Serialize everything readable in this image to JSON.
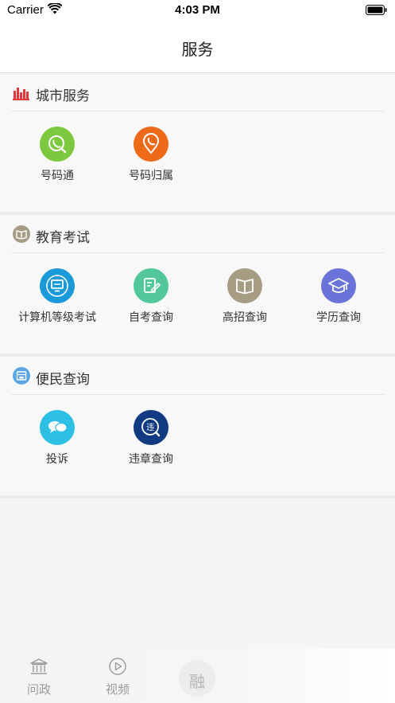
{
  "status_bar": {
    "carrier": "Carrier",
    "time": "4:03 PM"
  },
  "nav": {
    "title": "服务"
  },
  "sections": [
    {
      "title": "城市服务",
      "icon": "city-skyline-icon",
      "color": "#e4393c",
      "items": [
        {
          "label": "号码通",
          "icon": "phone-search-icon",
          "color": "#7cc93f"
        },
        {
          "label": "号码归属",
          "icon": "phone-location-icon",
          "color": "#ee6a18"
        }
      ]
    },
    {
      "title": "教育考试",
      "icon": "book-icon",
      "color": "#a69c83",
      "items": [
        {
          "label": "计算机等级考试",
          "icon": "computer-icon",
          "color": "#1a9ad8"
        },
        {
          "label": "自考查询",
          "icon": "edit-icon",
          "color": "#52c89a"
        },
        {
          "label": "高招查询",
          "icon": "open-book-icon",
          "color": "#a69c83"
        },
        {
          "label": "学历查询",
          "icon": "graduation-cap-icon",
          "color": "#6a74d8"
        }
      ]
    },
    {
      "title": "便民查询",
      "icon": "service-window-icon",
      "color": "#5aa5e8",
      "items": [
        {
          "label": "投诉",
          "icon": "chat-bubbles-icon",
          "color": "#2ec0e4"
        },
        {
          "label": "违章查询",
          "icon": "violation-search-icon",
          "color": "#103a82",
          "badge": "违"
        }
      ]
    }
  ],
  "tabs": [
    {
      "label": "问政",
      "icon": "government-building-icon"
    },
    {
      "label": "视频",
      "icon": "play-circle-icon"
    },
    {
      "label": "融",
      "icon": "rong-logo"
    }
  ],
  "colors": {
    "tab_inactive": "#9a9a9a",
    "text": "#333333"
  }
}
